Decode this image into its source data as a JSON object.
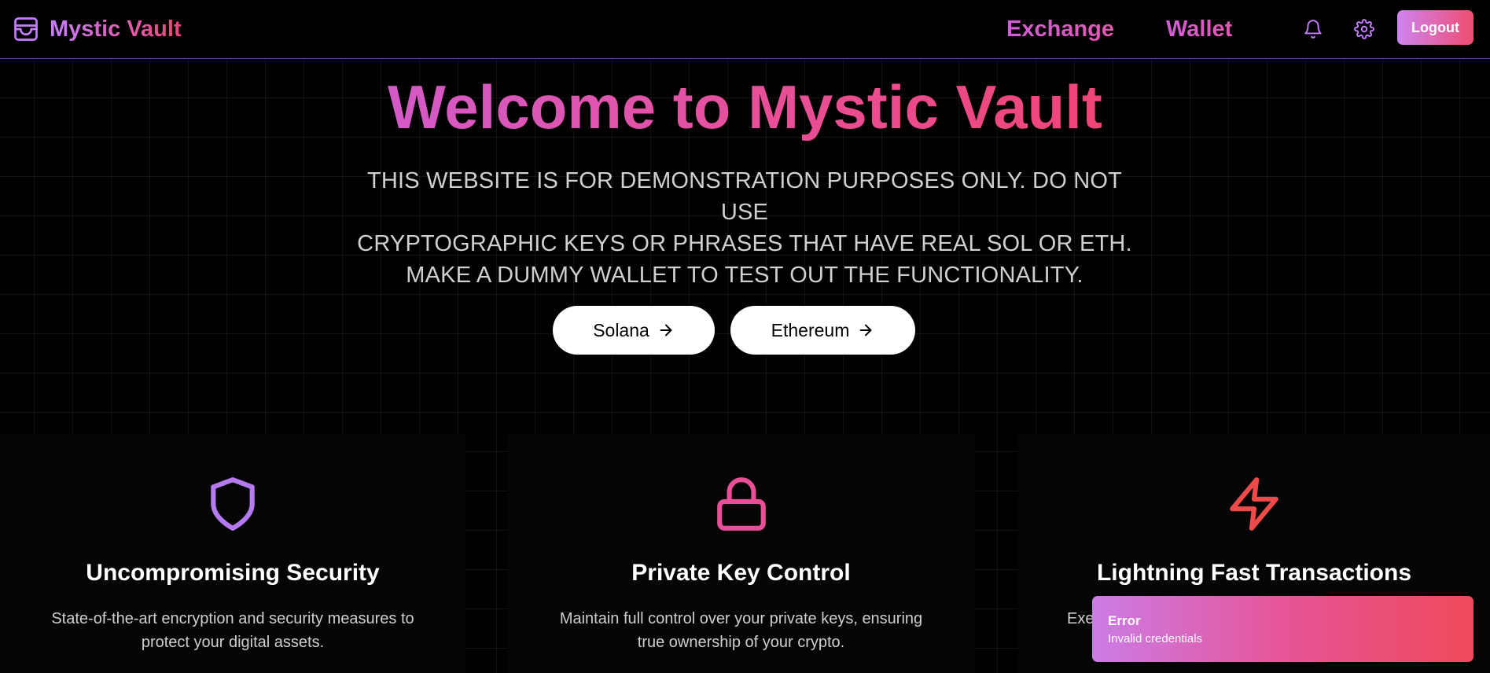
{
  "header": {
    "brand_name": "Mystic Vault",
    "nav": [
      {
        "label": "Exchange"
      },
      {
        "label": "Wallet"
      }
    ],
    "logout_label": "Logout",
    "icons": {
      "brand": "wallet-icon",
      "notifications": "bell-icon",
      "settings": "gear-icon"
    }
  },
  "hero": {
    "title": "Welcome to Mystic Vault",
    "notice_lines": [
      "THIS WEBSITE IS FOR DEMONSTRATION PURPOSES ONLY. DO NOT USE",
      "CRYPTOGRAPHIC KEYS OR PHRASES THAT HAVE REAL SOL OR ETH.",
      "MAKE A DUMMY WALLET TO TEST OUT THE FUNCTIONALITY."
    ],
    "buttons": [
      {
        "label": "Solana",
        "icon": "arrow-right-icon"
      },
      {
        "label": "Ethereum",
        "icon": "arrow-right-icon"
      }
    ]
  },
  "features": [
    {
      "icon": "shield-icon",
      "title": "Uncompromising Security",
      "description": "State-of-the-art encryption and security measures to protect your digital assets."
    },
    {
      "icon": "lock-icon",
      "title": "Private Key Control",
      "description": "Maintain full control over your private keys, ensuring true ownership of your crypto."
    },
    {
      "icon": "lightning-icon",
      "title": "Lightning Fast Transactions",
      "description": "Exe"
    }
  ],
  "toast": {
    "title": "Error",
    "message": "Invalid credentials"
  },
  "colors": {
    "accent_purple": "#c77dff",
    "accent_pink": "#e84f97",
    "accent_red": "#ef4a5a",
    "background": "#000000"
  }
}
